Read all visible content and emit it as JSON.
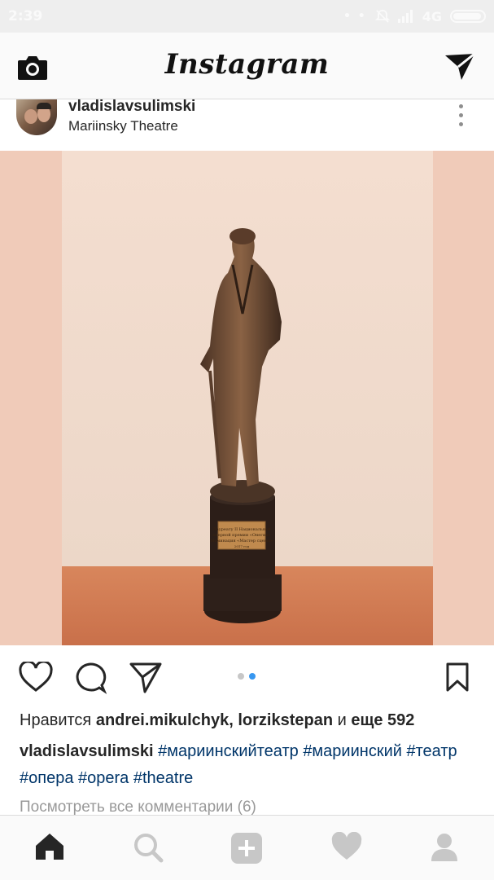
{
  "status_bar": {
    "time": "2:39",
    "network": "4G",
    "signal_dots": "• •"
  },
  "header": {
    "logo": "Instagram",
    "left_icon": "camera-icon",
    "right_icon": "direct-send-icon"
  },
  "post": {
    "username": "vladislavsulimski",
    "location": "Mariinsky Theatre",
    "image_plaque_text": "Лауреату II Национальной оперной премии «Онегин» Номинация «Мастер сцены» 2017 год",
    "carousel": {
      "count": 2,
      "active_index": 1
    },
    "likes": {
      "prefix": "Нравится",
      "users": "andrei.mikulchyk, lorzikstepan",
      "connector": "и",
      "more": "еще 592"
    },
    "caption": {
      "username": "vladislavsulimski",
      "tags": [
        "#мариинскийтеатр",
        "#мариинский",
        "#театр",
        "#опера",
        "#opera",
        "#theatre"
      ]
    },
    "view_comments": "Посмотреть все комментарии (6)"
  },
  "bottom_nav": [
    "home-icon",
    "search-icon",
    "add-post-icon",
    "activity-heart-icon",
    "profile-icon"
  ],
  "colors": {
    "hashtag": "#003569",
    "carousel_active": "#3897f0",
    "text": "#262626",
    "muted": "#999999"
  }
}
